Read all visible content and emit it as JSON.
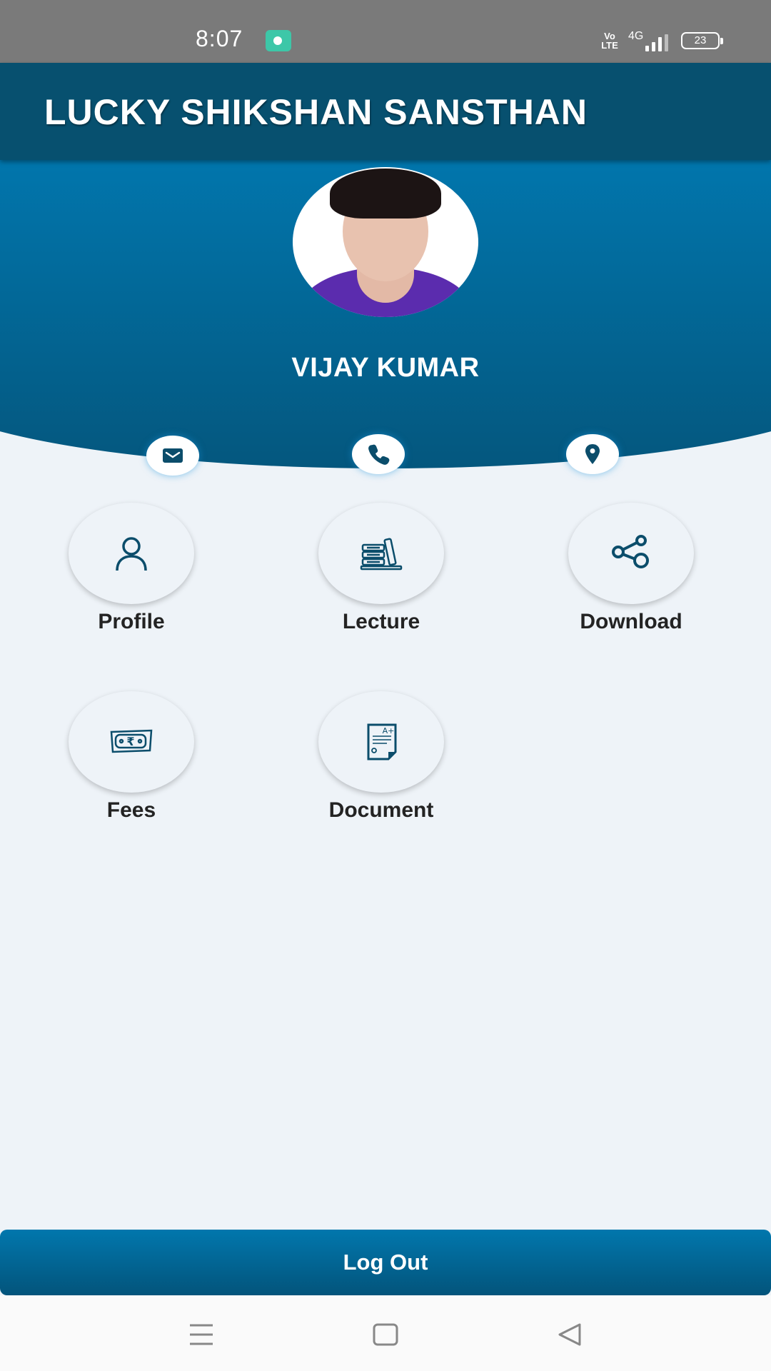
{
  "status_bar": {
    "time": "8:07",
    "volte": "Vo\nLTE",
    "network": "4G",
    "battery": "23"
  },
  "app_bar": {
    "title": "LUCKY SHIKSHAN SANSTHAN"
  },
  "profile": {
    "name": "VIJAY KUMAR",
    "contacts": [
      {
        "icon": "mail-icon",
        "label": "Email"
      },
      {
        "icon": "phone-icon",
        "label": "Phone"
      },
      {
        "icon": "location-icon",
        "label": "Location"
      }
    ]
  },
  "menu": {
    "items": [
      {
        "label": "Profile",
        "icon": "person-icon"
      },
      {
        "label": "Lecture",
        "icon": "books-icon"
      },
      {
        "label": "Download",
        "icon": "share-icon"
      },
      {
        "label": "Fees",
        "icon": "rupee-note-icon"
      },
      {
        "label": "Document",
        "icon": "certificate-icon"
      }
    ]
  },
  "logout": {
    "label": "Log Out"
  },
  "colors": {
    "primary_dark": "#07506f",
    "primary": "#0176ad",
    "icon": "#0b4d6b",
    "background": "#eef3f8"
  }
}
